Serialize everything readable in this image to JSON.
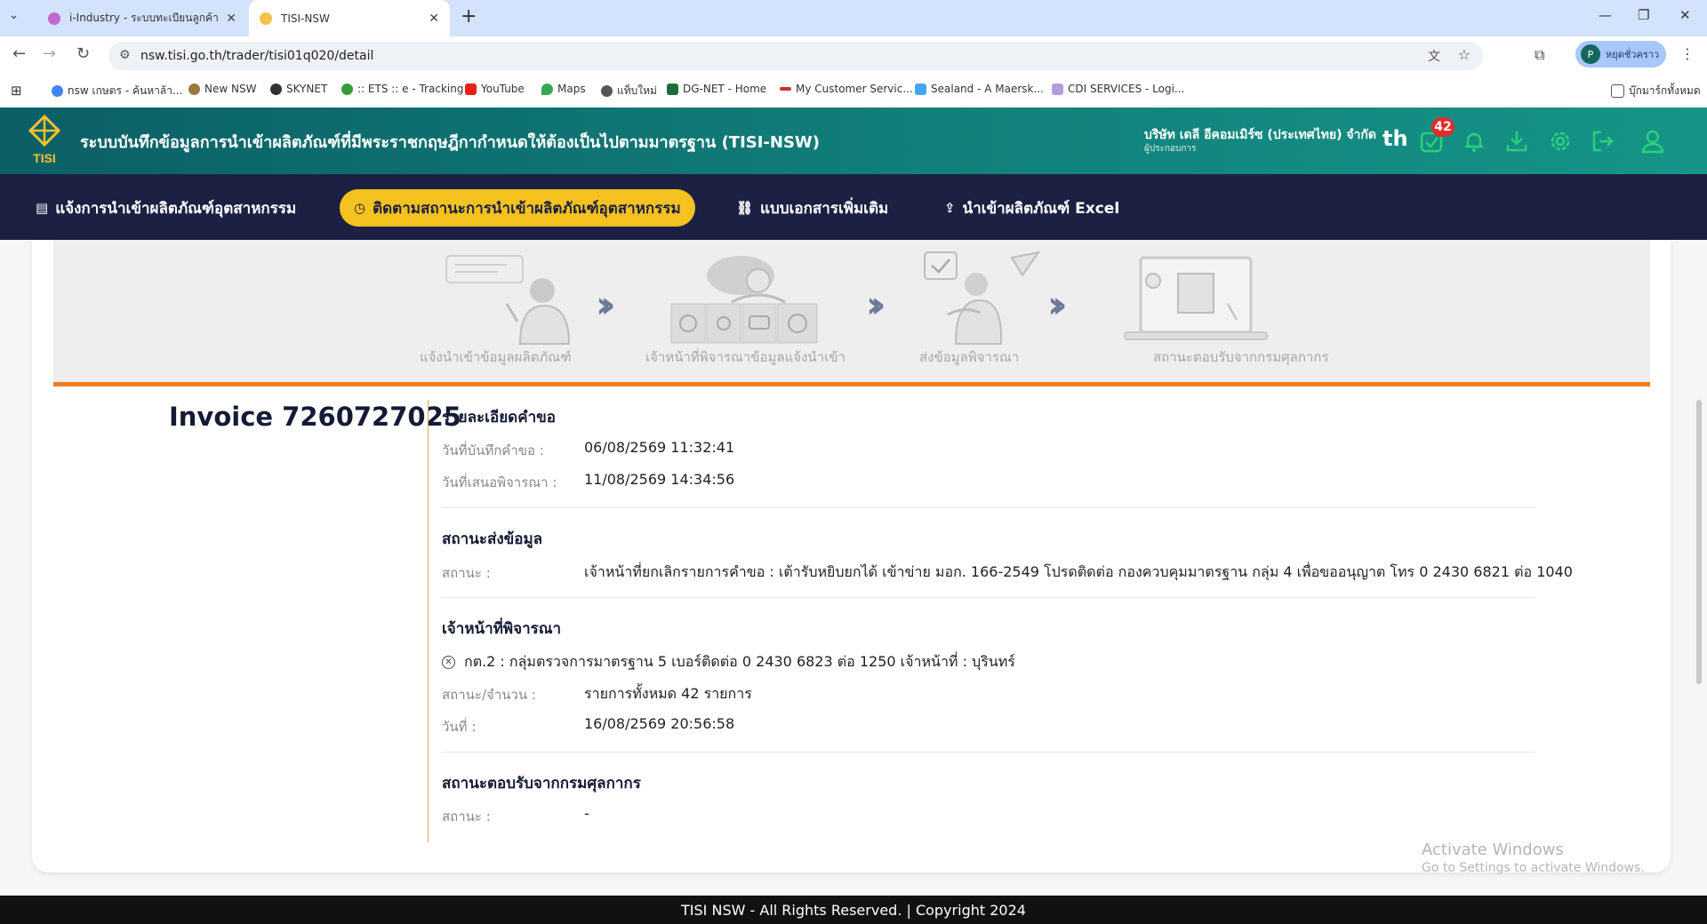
{
  "browser": {
    "tabs": [
      {
        "title": "i-Industry - ระบบทะเบียนลูกค้ากระ",
        "active": false
      },
      {
        "title": "TISI-NSW",
        "active": true
      }
    ],
    "url": "nsw.tisi.go.th/trader/tisi01q020/detail",
    "profile_initial": "P",
    "profile_label": "หยุดชั่วคราว",
    "bookmarks": [
      "nsw เกษตร - ค้นหาล้า...",
      "New NSW",
      "SKYNET",
      ":: ETS :: e - Tracking",
      "YouTube",
      "Maps",
      "แท็บใหม่",
      "DG-NET - Home",
      "My Customer Servic...",
      "Sealand - A Maersk...",
      "CDI SERVICES - Logi..."
    ],
    "all_bookmarks": "บุ๊กมาร์กทั้งหมด"
  },
  "header": {
    "logo_text": "TISI",
    "title": "ระบบบันทึกข้อมูลการนำเข้าผลิตภัณฑ์ที่มีพระราชกฤษฎีกากำหนดให้ต้องเป็นไปตามมาตรฐาน (TISI-NSW)",
    "company": "บริษัท เดลี อีคอมเมิร์ซ (ประเทศไทย) จำกัด",
    "role": "ผู้ประกอบการ",
    "lang": "th",
    "badge_count": "42"
  },
  "nav": {
    "items": [
      {
        "label": "แจ้งการนำเข้าผลิตภัณฑ์อุตสาหกรรม",
        "active": false
      },
      {
        "label": "ติดตามสถานะการนำเข้าผลิตภัณฑ์อุตสาหกรรม",
        "active": true
      },
      {
        "label": "แบบเอกสารเพิ่มเติม",
        "active": false
      },
      {
        "label": "นำเข้าผลิตภัณฑ์ Excel",
        "active": false
      }
    ]
  },
  "steps": [
    "แจ้งนำเข้าข้อมูลผลิตภัณฑ์",
    "เจ้าหน้าที่พิจารณาข้อมูลแจ้งนำเข้า",
    "ส่งข้อมูลพิจารณา",
    "สถานะตอบรับจากกรมศุลกากร"
  ],
  "invoice_title": "Invoice 7260727025",
  "request": {
    "heading": "รายละเอียดคำขอ",
    "recorded_label": "วันที่บันทึกคำขอ :",
    "recorded_value": "06/08/2569 11:32:41",
    "submitted_label": "วันที่เสนอพิจารณา :",
    "submitted_value": "11/08/2569 14:34:56"
  },
  "send_status": {
    "heading": "สถานะส่งข้อมูล",
    "status_label": "สถานะ :",
    "status_value": "เจ้าหน้าที่ยกเลิกรายการคำขอ : เต้ารับหยิบยกได้ เข้าข่าย มอก. 166-2549 โปรดติดต่อ กองควบคุมมาตรฐาน กลุ่ม 4 เพื่อขออนุญาต โทร 0 2430 6821 ต่อ 1040"
  },
  "officer": {
    "heading": "เจ้าหน้าที่พิจารณา",
    "line": "กต.2 : กลุ่มตรวจการมาตรฐาน 5 เบอร์ติดต่อ 0 2430 6823 ต่อ 1250 เจ้าหน้าที่ : บุรินทร์",
    "count_label": "สถานะ/จำนวน :",
    "count_value": "รายการทั้งหมด 42 รายการ",
    "date_label": "วันที่ :",
    "date_value": "16/08/2569 20:56:58"
  },
  "customs": {
    "heading": "สถานะตอบรับจากกรมศุลกากร",
    "status_label": "สถานะ :",
    "status_value": "-"
  },
  "watermark": {
    "line1": "Activate Windows",
    "line2": "Go to Settings to activate Windows."
  },
  "footer": "TISI NSW - All Rights Reserved. | Copyright 2024",
  "colors": {
    "header_teal": "#11807a",
    "nav_navy": "#1c2143",
    "active_yellow": "#f6c21f",
    "accent_orange": "#ee7d22"
  }
}
